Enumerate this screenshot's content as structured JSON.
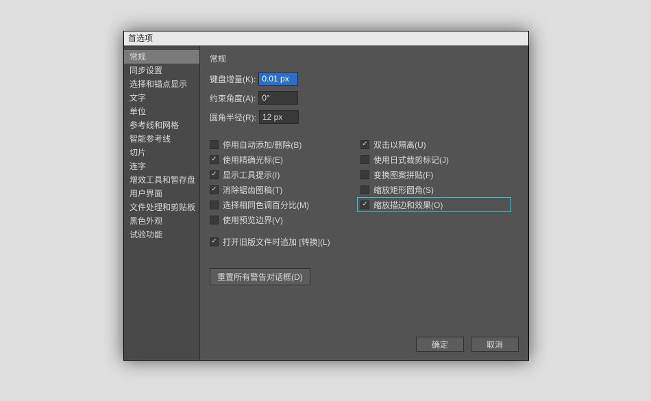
{
  "dialog": {
    "title": "首选项"
  },
  "sidebar": {
    "items": [
      {
        "label": "常规",
        "selected": true
      },
      {
        "label": "同步设置"
      },
      {
        "label": "选择和锚点显示"
      },
      {
        "label": "文字"
      },
      {
        "label": "单位"
      },
      {
        "label": "参考线和网格"
      },
      {
        "label": "智能参考线"
      },
      {
        "label": "切片"
      },
      {
        "label": "连字"
      },
      {
        "label": "增效工具和暂存盘"
      },
      {
        "label": "用户界面"
      },
      {
        "label": "文件处理和剪贴板"
      },
      {
        "label": "黑色外观"
      },
      {
        "label": "试验功能"
      }
    ]
  },
  "panel": {
    "title": "常规",
    "fields": {
      "keyboard_increment": {
        "label": "键盘增量(K):",
        "value": "0.01 px"
      },
      "constraint_angle": {
        "label": "约束角度(A):",
        "value": "0°"
      },
      "corner_radius": {
        "label": "圆角半径(R):",
        "value": "12 px"
      }
    },
    "checks_left": [
      {
        "label": "停用自动添加/删除(B)",
        "checked": false
      },
      {
        "label": "使用精确光标(E)",
        "checked": true
      },
      {
        "label": "显示工具提示(I)",
        "checked": true
      },
      {
        "label": "消除锯齿图稿(T)",
        "checked": true
      },
      {
        "label": "选择相同色调百分比(M)",
        "checked": false
      },
      {
        "label": "使用预览边界(V)",
        "checked": false
      }
    ],
    "checks_right": [
      {
        "label": "双击以隔离(U)",
        "checked": true
      },
      {
        "label": "使用日式裁剪标记(J)",
        "checked": false
      },
      {
        "label": "变换图案拼贴(F)",
        "checked": false
      },
      {
        "label": "缩放矩形圆角(S)",
        "checked": false
      },
      {
        "label": "缩放描边和效果(O)",
        "checked": true,
        "highlight": true
      }
    ],
    "open_legacy": {
      "label": "打开旧版文件时追加 [转换](L)",
      "checked": true
    },
    "reset_button": "重置所有警告对话框(D)",
    "ok": "确定",
    "cancel": "取消"
  }
}
